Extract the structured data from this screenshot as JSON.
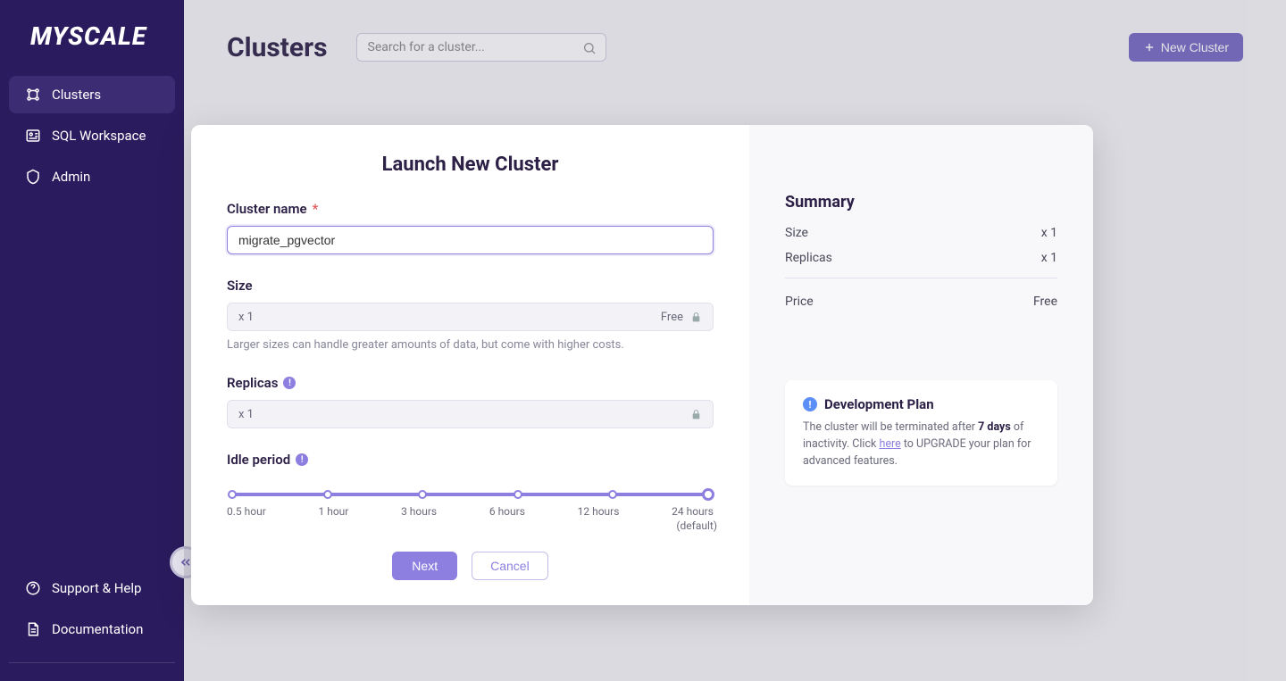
{
  "brand": "MYSCALE",
  "sidebar": {
    "items": [
      {
        "label": "Clusters"
      },
      {
        "label": "SQL Workspace"
      },
      {
        "label": "Admin"
      }
    ],
    "footer": [
      {
        "label": "Support & Help"
      },
      {
        "label": "Documentation"
      }
    ]
  },
  "topbar": {
    "title": "Clusters",
    "searchPlaceholder": "Search for a cluster...",
    "newClusterLabel": "New Cluster"
  },
  "modal": {
    "title": "Launch New Cluster",
    "clusterNameLabel": "Cluster name",
    "clusterNameValue": "migrate_pgvector",
    "sizeLabel": "Size",
    "sizeValue": "x 1",
    "sizeBadge": "Free",
    "sizeHelper": "Larger sizes can handle greater amounts of data, but come with higher costs.",
    "replicasLabel": "Replicas",
    "replicasValue": "x 1",
    "idleLabel": "Idle period",
    "idleOptions": [
      "0.5 hour",
      "1 hour",
      "3 hours",
      "6 hours",
      "12 hours",
      "24 hours"
    ],
    "idleDefaultNote": "(default)",
    "nextLabel": "Next",
    "cancelLabel": "Cancel"
  },
  "summary": {
    "title": "Summary",
    "rows": [
      {
        "label": "Size",
        "value": "x 1"
      },
      {
        "label": "Replicas",
        "value": "x 1"
      }
    ],
    "priceLabel": "Price",
    "priceValue": "Free"
  },
  "devPlan": {
    "title": "Development Plan",
    "prefix": "The cluster will be terminated after ",
    "bold": "7 days",
    "mid": " of inactivity. Click ",
    "link": "here",
    "suffix": " to UPGRADE your plan for advanced features."
  }
}
